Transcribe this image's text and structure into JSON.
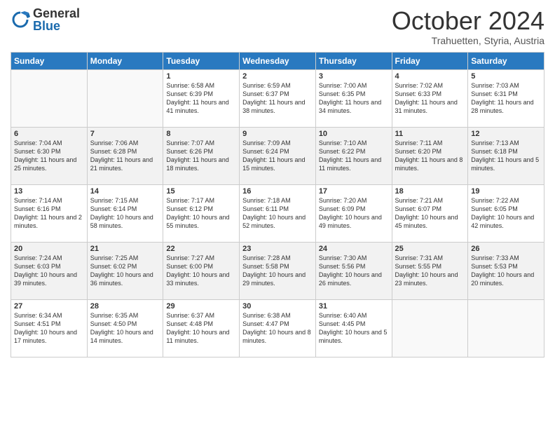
{
  "logo": {
    "general": "General",
    "blue": "Blue"
  },
  "header": {
    "month": "October 2024",
    "location": "Trahuetten, Styria, Austria"
  },
  "weekdays": [
    "Sunday",
    "Monday",
    "Tuesday",
    "Wednesday",
    "Thursday",
    "Friday",
    "Saturday"
  ],
  "weeks": [
    [
      {
        "day": "",
        "info": ""
      },
      {
        "day": "",
        "info": ""
      },
      {
        "day": "1",
        "info": "Sunrise: 6:58 AM\nSunset: 6:39 PM\nDaylight: 11 hours and 41 minutes."
      },
      {
        "day": "2",
        "info": "Sunrise: 6:59 AM\nSunset: 6:37 PM\nDaylight: 11 hours and 38 minutes."
      },
      {
        "day": "3",
        "info": "Sunrise: 7:00 AM\nSunset: 6:35 PM\nDaylight: 11 hours and 34 minutes."
      },
      {
        "day": "4",
        "info": "Sunrise: 7:02 AM\nSunset: 6:33 PM\nDaylight: 11 hours and 31 minutes."
      },
      {
        "day": "5",
        "info": "Sunrise: 7:03 AM\nSunset: 6:31 PM\nDaylight: 11 hours and 28 minutes."
      }
    ],
    [
      {
        "day": "6",
        "info": "Sunrise: 7:04 AM\nSunset: 6:30 PM\nDaylight: 11 hours and 25 minutes."
      },
      {
        "day": "7",
        "info": "Sunrise: 7:06 AM\nSunset: 6:28 PM\nDaylight: 11 hours and 21 minutes."
      },
      {
        "day": "8",
        "info": "Sunrise: 7:07 AM\nSunset: 6:26 PM\nDaylight: 11 hours and 18 minutes."
      },
      {
        "day": "9",
        "info": "Sunrise: 7:09 AM\nSunset: 6:24 PM\nDaylight: 11 hours and 15 minutes."
      },
      {
        "day": "10",
        "info": "Sunrise: 7:10 AM\nSunset: 6:22 PM\nDaylight: 11 hours and 11 minutes."
      },
      {
        "day": "11",
        "info": "Sunrise: 7:11 AM\nSunset: 6:20 PM\nDaylight: 11 hours and 8 minutes."
      },
      {
        "day": "12",
        "info": "Sunrise: 7:13 AM\nSunset: 6:18 PM\nDaylight: 11 hours and 5 minutes."
      }
    ],
    [
      {
        "day": "13",
        "info": "Sunrise: 7:14 AM\nSunset: 6:16 PM\nDaylight: 11 hours and 2 minutes."
      },
      {
        "day": "14",
        "info": "Sunrise: 7:15 AM\nSunset: 6:14 PM\nDaylight: 10 hours and 58 minutes."
      },
      {
        "day": "15",
        "info": "Sunrise: 7:17 AM\nSunset: 6:12 PM\nDaylight: 10 hours and 55 minutes."
      },
      {
        "day": "16",
        "info": "Sunrise: 7:18 AM\nSunset: 6:11 PM\nDaylight: 10 hours and 52 minutes."
      },
      {
        "day": "17",
        "info": "Sunrise: 7:20 AM\nSunset: 6:09 PM\nDaylight: 10 hours and 49 minutes."
      },
      {
        "day": "18",
        "info": "Sunrise: 7:21 AM\nSunset: 6:07 PM\nDaylight: 10 hours and 45 minutes."
      },
      {
        "day": "19",
        "info": "Sunrise: 7:22 AM\nSunset: 6:05 PM\nDaylight: 10 hours and 42 minutes."
      }
    ],
    [
      {
        "day": "20",
        "info": "Sunrise: 7:24 AM\nSunset: 6:03 PM\nDaylight: 10 hours and 39 minutes."
      },
      {
        "day": "21",
        "info": "Sunrise: 7:25 AM\nSunset: 6:02 PM\nDaylight: 10 hours and 36 minutes."
      },
      {
        "day": "22",
        "info": "Sunrise: 7:27 AM\nSunset: 6:00 PM\nDaylight: 10 hours and 33 minutes."
      },
      {
        "day": "23",
        "info": "Sunrise: 7:28 AM\nSunset: 5:58 PM\nDaylight: 10 hours and 29 minutes."
      },
      {
        "day": "24",
        "info": "Sunrise: 7:30 AM\nSunset: 5:56 PM\nDaylight: 10 hours and 26 minutes."
      },
      {
        "day": "25",
        "info": "Sunrise: 7:31 AM\nSunset: 5:55 PM\nDaylight: 10 hours and 23 minutes."
      },
      {
        "day": "26",
        "info": "Sunrise: 7:33 AM\nSunset: 5:53 PM\nDaylight: 10 hours and 20 minutes."
      }
    ],
    [
      {
        "day": "27",
        "info": "Sunrise: 6:34 AM\nSunset: 4:51 PM\nDaylight: 10 hours and 17 minutes."
      },
      {
        "day": "28",
        "info": "Sunrise: 6:35 AM\nSunset: 4:50 PM\nDaylight: 10 hours and 14 minutes."
      },
      {
        "day": "29",
        "info": "Sunrise: 6:37 AM\nSunset: 4:48 PM\nDaylight: 10 hours and 11 minutes."
      },
      {
        "day": "30",
        "info": "Sunrise: 6:38 AM\nSunset: 4:47 PM\nDaylight: 10 hours and 8 minutes."
      },
      {
        "day": "31",
        "info": "Sunrise: 6:40 AM\nSunset: 4:45 PM\nDaylight: 10 hours and 5 minutes."
      },
      {
        "day": "",
        "info": ""
      },
      {
        "day": "",
        "info": ""
      }
    ]
  ]
}
